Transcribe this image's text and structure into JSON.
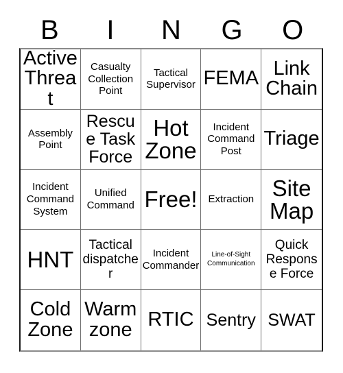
{
  "card": {
    "title": "Bingo Card",
    "header_letters": [
      "B",
      "I",
      "N",
      "G",
      "O"
    ],
    "columns": 5,
    "rows": 5,
    "free_space_label": "Free!",
    "free_space_index": 12,
    "colors": {
      "text": "#000000",
      "background": "#ffffff",
      "grid_line": "#6f6f6f",
      "outer_border": "#1a1a1a"
    },
    "cells": [
      {
        "text": "Active Threat",
        "size": "xl"
      },
      {
        "text": "Casualty Collection Point",
        "size": "s"
      },
      {
        "text": "Tactical Supervisor",
        "size": "s"
      },
      {
        "text": "FEMA",
        "size": "xl"
      },
      {
        "text": "Link Chain",
        "size": "xl"
      },
      {
        "text": "Assembly Point",
        "size": "s"
      },
      {
        "text": "Rescue Task Force",
        "size": "l"
      },
      {
        "text": "Hot Zone",
        "size": "xxl"
      },
      {
        "text": "Incident Command Post",
        "size": "s"
      },
      {
        "text": "Triage",
        "size": "xl"
      },
      {
        "text": "Incident Command System",
        "size": "s"
      },
      {
        "text": "Unified Command",
        "size": "s"
      },
      {
        "text": "Free!",
        "size": "xxl"
      },
      {
        "text": "Extraction",
        "size": "s"
      },
      {
        "text": "Site Map",
        "size": "xxl"
      },
      {
        "text": "HNT",
        "size": "xxl"
      },
      {
        "text": "Tactical dispatcher",
        "size": "m"
      },
      {
        "text": "Incident Commander",
        "size": "s"
      },
      {
        "text": "Line-of-Sight Communication",
        "size": "xxs"
      },
      {
        "text": "Quick Response Force",
        "size": "m"
      },
      {
        "text": "Cold Zone",
        "size": "xl"
      },
      {
        "text": "Warm zone",
        "size": "xl"
      },
      {
        "text": "RTIC",
        "size": "xl"
      },
      {
        "text": "Sentry",
        "size": "l"
      },
      {
        "text": "SWAT",
        "size": "l"
      }
    ]
  }
}
